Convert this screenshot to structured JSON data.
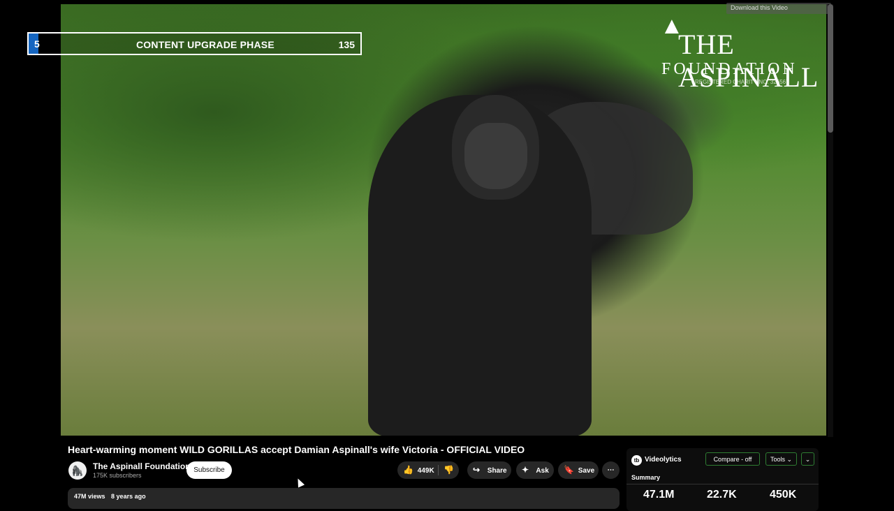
{
  "overlay": {
    "chapter_number": "5",
    "chapter_title": "CONTENT UPGRADE PHASE",
    "chapter_count": "135"
  },
  "watermark": {
    "mark": "▲",
    "name": "THE ASPINALL",
    "foundation": "FOUNDATION",
    "registration": "REGISTERED CHARITY NO. 326567"
  },
  "top_right_button": "Download this Video",
  "video": {
    "title": "Heart-warming moment WILD GORILLAS accept Damian Aspinall's wife Victoria - OFFICIAL VIDEO",
    "channel_name": "The Aspinall Foundation",
    "subscribers": "175K subscribers",
    "subscribe_label": "Subscribe",
    "likes": "449K",
    "share_label": "Share",
    "ask_label": "Ask",
    "save_label": "Save",
    "views": "47M views",
    "age": "8 years ago"
  },
  "icons": {
    "like": "👍",
    "dislike": "👎",
    "share": "↪",
    "ask": "✦",
    "save": "🔖",
    "more": "⋯"
  },
  "videolytics": {
    "logo_text": "tb",
    "name": "Videolytics",
    "compare_label": "Compare - off",
    "tools_label": "Tools ⌄",
    "dropdown_label": "⌄",
    "summary_label": "Summary",
    "stats": [
      "47.1M",
      "22.7K",
      "450K"
    ]
  }
}
